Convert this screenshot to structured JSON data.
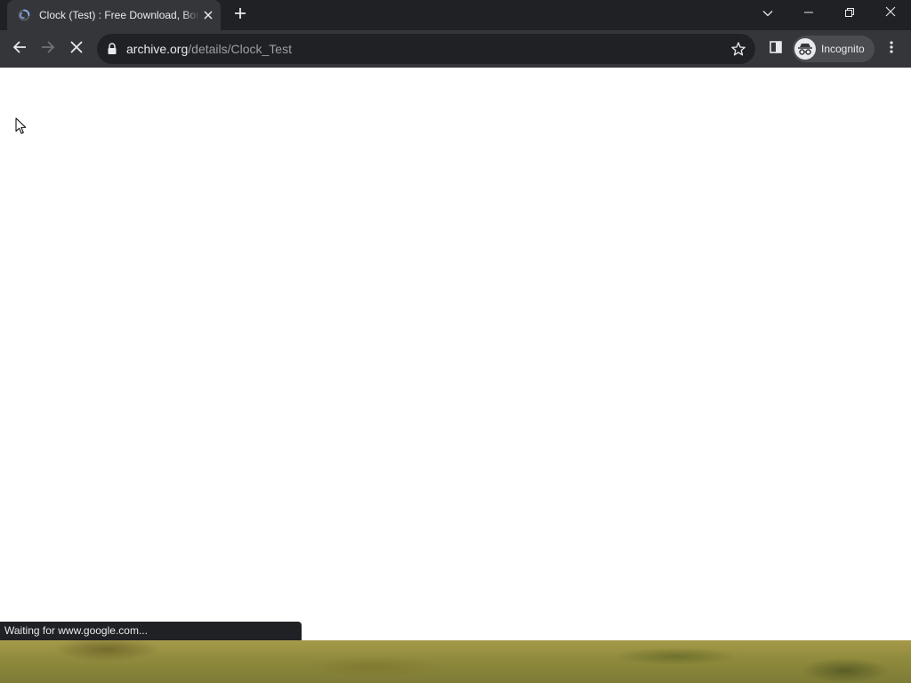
{
  "browser": {
    "tab": {
      "title": "Clock (Test) : Free Download, Borrow, and Streaming : Internet Archive"
    },
    "address_bar": {
      "host": "archive.org",
      "path": "/details/Clock_Test"
    },
    "profile": {
      "label": "Incognito"
    },
    "status_bar": {
      "text": "Waiting for www.google.com..."
    },
    "icons": {
      "favicon": "loading-spinner-icon",
      "tab_close": "close-icon",
      "new_tab": "plus-icon",
      "tab_search": "chevron-down-icon",
      "minimize": "minimize-icon",
      "restore": "restore-icon",
      "close_window": "close-icon",
      "back": "arrow-left-icon",
      "forward": "arrow-right-icon",
      "stop": "stop-icon",
      "lock": "lock-icon",
      "bookmark": "star-icon",
      "side_panel": "side-panel-icon",
      "incognito": "incognito-icon",
      "menu": "kebab-menu-icon"
    },
    "colors": {
      "frame": "#202124",
      "toolbar": "#35363a",
      "text": "#e8eaed",
      "muted_text": "#9aa0a6"
    }
  }
}
